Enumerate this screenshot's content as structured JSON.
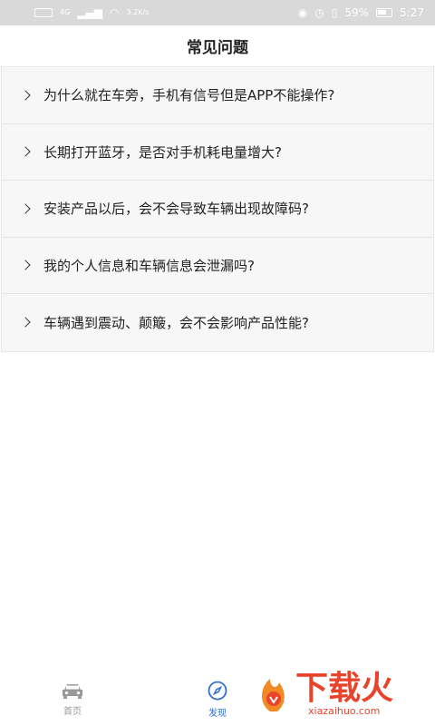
{
  "status_bar": {
    "left_small_1": "4G",
    "left_small_2": "3.2K/s",
    "battery_percent": "59%",
    "time": "5:27"
  },
  "header": {
    "title": "常见问题"
  },
  "faq": {
    "items": [
      {
        "text": "为什么就在车旁，手机有信号但是APP不能操作?"
      },
      {
        "text": "长期打开蓝牙，是否对手机耗电量增大?"
      },
      {
        "text": "安装产品以后，会不会导致车辆出现故障码?"
      },
      {
        "text": "我的个人信息和车辆信息会泄漏吗?"
      },
      {
        "text": "车辆遇到震动、颠簸，会不会影响产品性能?"
      }
    ]
  },
  "bottom_nav": {
    "home_label": "首页",
    "discover_label": "发现"
  },
  "watermark": {
    "brand": "下载火",
    "url": "xiazaihuo.com"
  },
  "colors": {
    "accent": "#2f6fd1",
    "watermark": "#e8432b"
  }
}
